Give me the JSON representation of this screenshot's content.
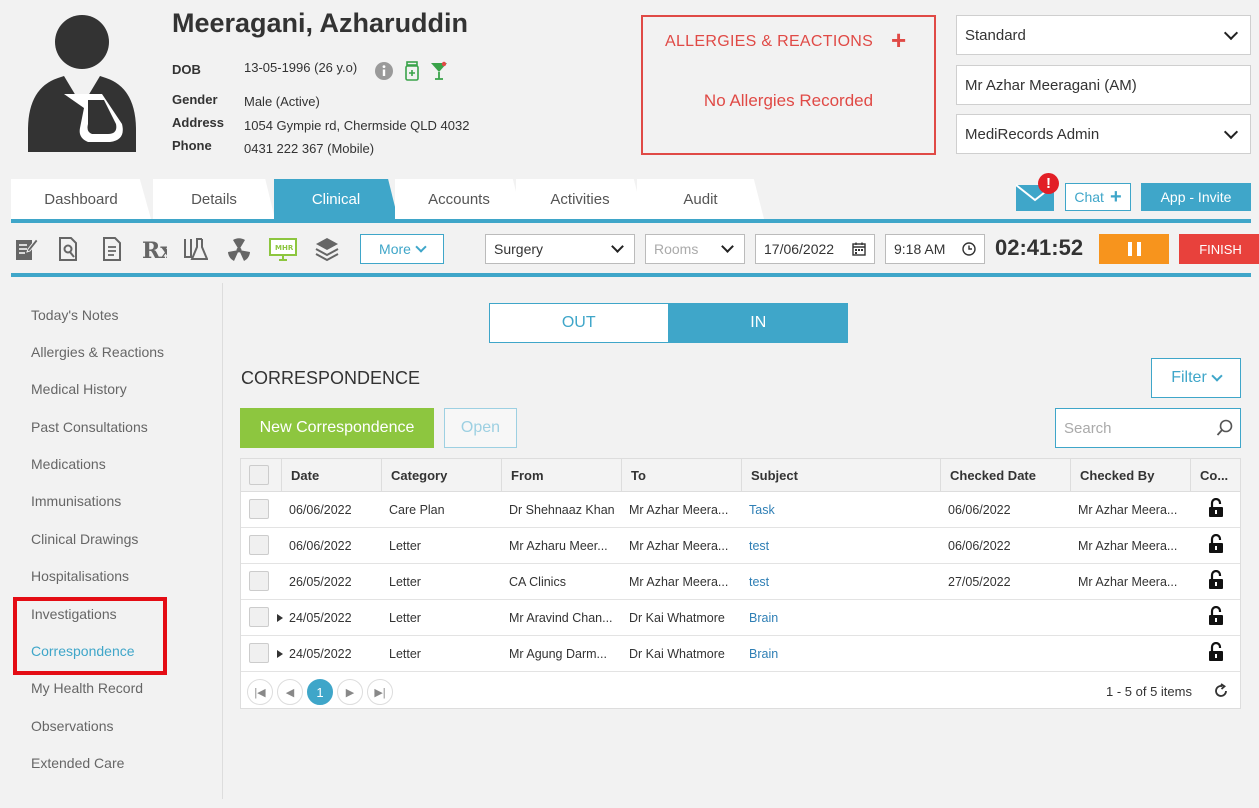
{
  "patient": {
    "name": "Meeragani, Azharuddin",
    "dob_label": "DOB",
    "dob": "13-05-1996 (26 y.o)",
    "gender_label": "Gender",
    "gender": "Male (Active)",
    "address_label": "Address",
    "address": "1054 Gympie rd, Chermside QLD 4032",
    "phone_label": "Phone",
    "phone": "0431 222 367 (Mobile)"
  },
  "allergies": {
    "title": "ALLERGIES & REACTIONS",
    "add": "+",
    "empty": "No Allergies Recorded"
  },
  "header_selects": {
    "mode": "Standard",
    "patient_name": "Mr Azhar Meeragani (AM)",
    "user": "MediRecords Admin"
  },
  "tabs": [
    {
      "label": "Dashboard"
    },
    {
      "label": "Details"
    },
    {
      "label": "Clinical"
    },
    {
      "label": "Accounts"
    },
    {
      "label": "Activities"
    },
    {
      "label": "Audit"
    }
  ],
  "top_actions": {
    "mail_badge": "!",
    "chat": "Chat",
    "app_invite": "App - Invite"
  },
  "toolbar": {
    "more": "More",
    "location": "Surgery",
    "rooms_placeholder": "Rooms",
    "date": "17/06/2022",
    "time": "9:18 AM",
    "timer": "02:41:52",
    "finish": "FINISH",
    "mhr_label": "MHR"
  },
  "sidebar": [
    "Today's Notes",
    "Allergies & Reactions",
    "Medical History",
    "Past Consultations",
    "Medications",
    "Immunisations",
    "Clinical Drawings",
    "Hospitalisations",
    "Investigations",
    "Correspondence",
    "My Health Record",
    "Observations",
    "Extended Care"
  ],
  "main": {
    "out": "OUT",
    "in": "IN",
    "title": "CORRESPONDENCE",
    "filter": "Filter",
    "new": "New Correspondence",
    "open": "Open",
    "search_placeholder": "Search"
  },
  "table": {
    "columns": [
      "Date",
      "Category",
      "From",
      "To",
      "Subject",
      "Checked Date",
      "Checked By",
      "Co..."
    ],
    "rows": [
      {
        "date": "06/06/2022",
        "category": "Care Plan",
        "from": "Dr Shehnaaz Khan",
        "to": "Mr Azhar Meera...",
        "subject": "Task",
        "checked_date": "06/06/2022",
        "checked_by": "Mr Azhar Meera...",
        "expandable": false
      },
      {
        "date": "06/06/2022",
        "category": "Letter",
        "from": "Mr Azharu Meer...",
        "to": "Mr Azhar Meera...",
        "subject": "test",
        "checked_date": "06/06/2022",
        "checked_by": "Mr Azhar Meera...",
        "expandable": false
      },
      {
        "date": "26/05/2022",
        "category": "Letter",
        "from": "CA Clinics",
        "to": "Mr Azhar Meera...",
        "subject": "test",
        "checked_date": "27/05/2022",
        "checked_by": "Mr Azhar Meera...",
        "expandable": false
      },
      {
        "date": "24/05/2022",
        "category": "Letter",
        "from": "Mr Aravind Chan...",
        "to": "Dr Kai Whatmore",
        "subject": "Brain",
        "checked_date": "",
        "checked_by": "",
        "expandable": true
      },
      {
        "date": "24/05/2022",
        "category": "Letter",
        "from": "Mr Agung Darm...",
        "to": "Dr Kai Whatmore",
        "subject": "Brain",
        "checked_date": "",
        "checked_by": "",
        "expandable": true
      }
    ],
    "pager": {
      "current": "1",
      "info": "1 - 5 of 5 items"
    }
  },
  "colors": {
    "accent": "#3fa6c9",
    "alert": "#e04a46",
    "new_button": "#8dc63f",
    "pause": "#f7941d",
    "finish": "#e8413c",
    "highlight": "#e40c14"
  }
}
